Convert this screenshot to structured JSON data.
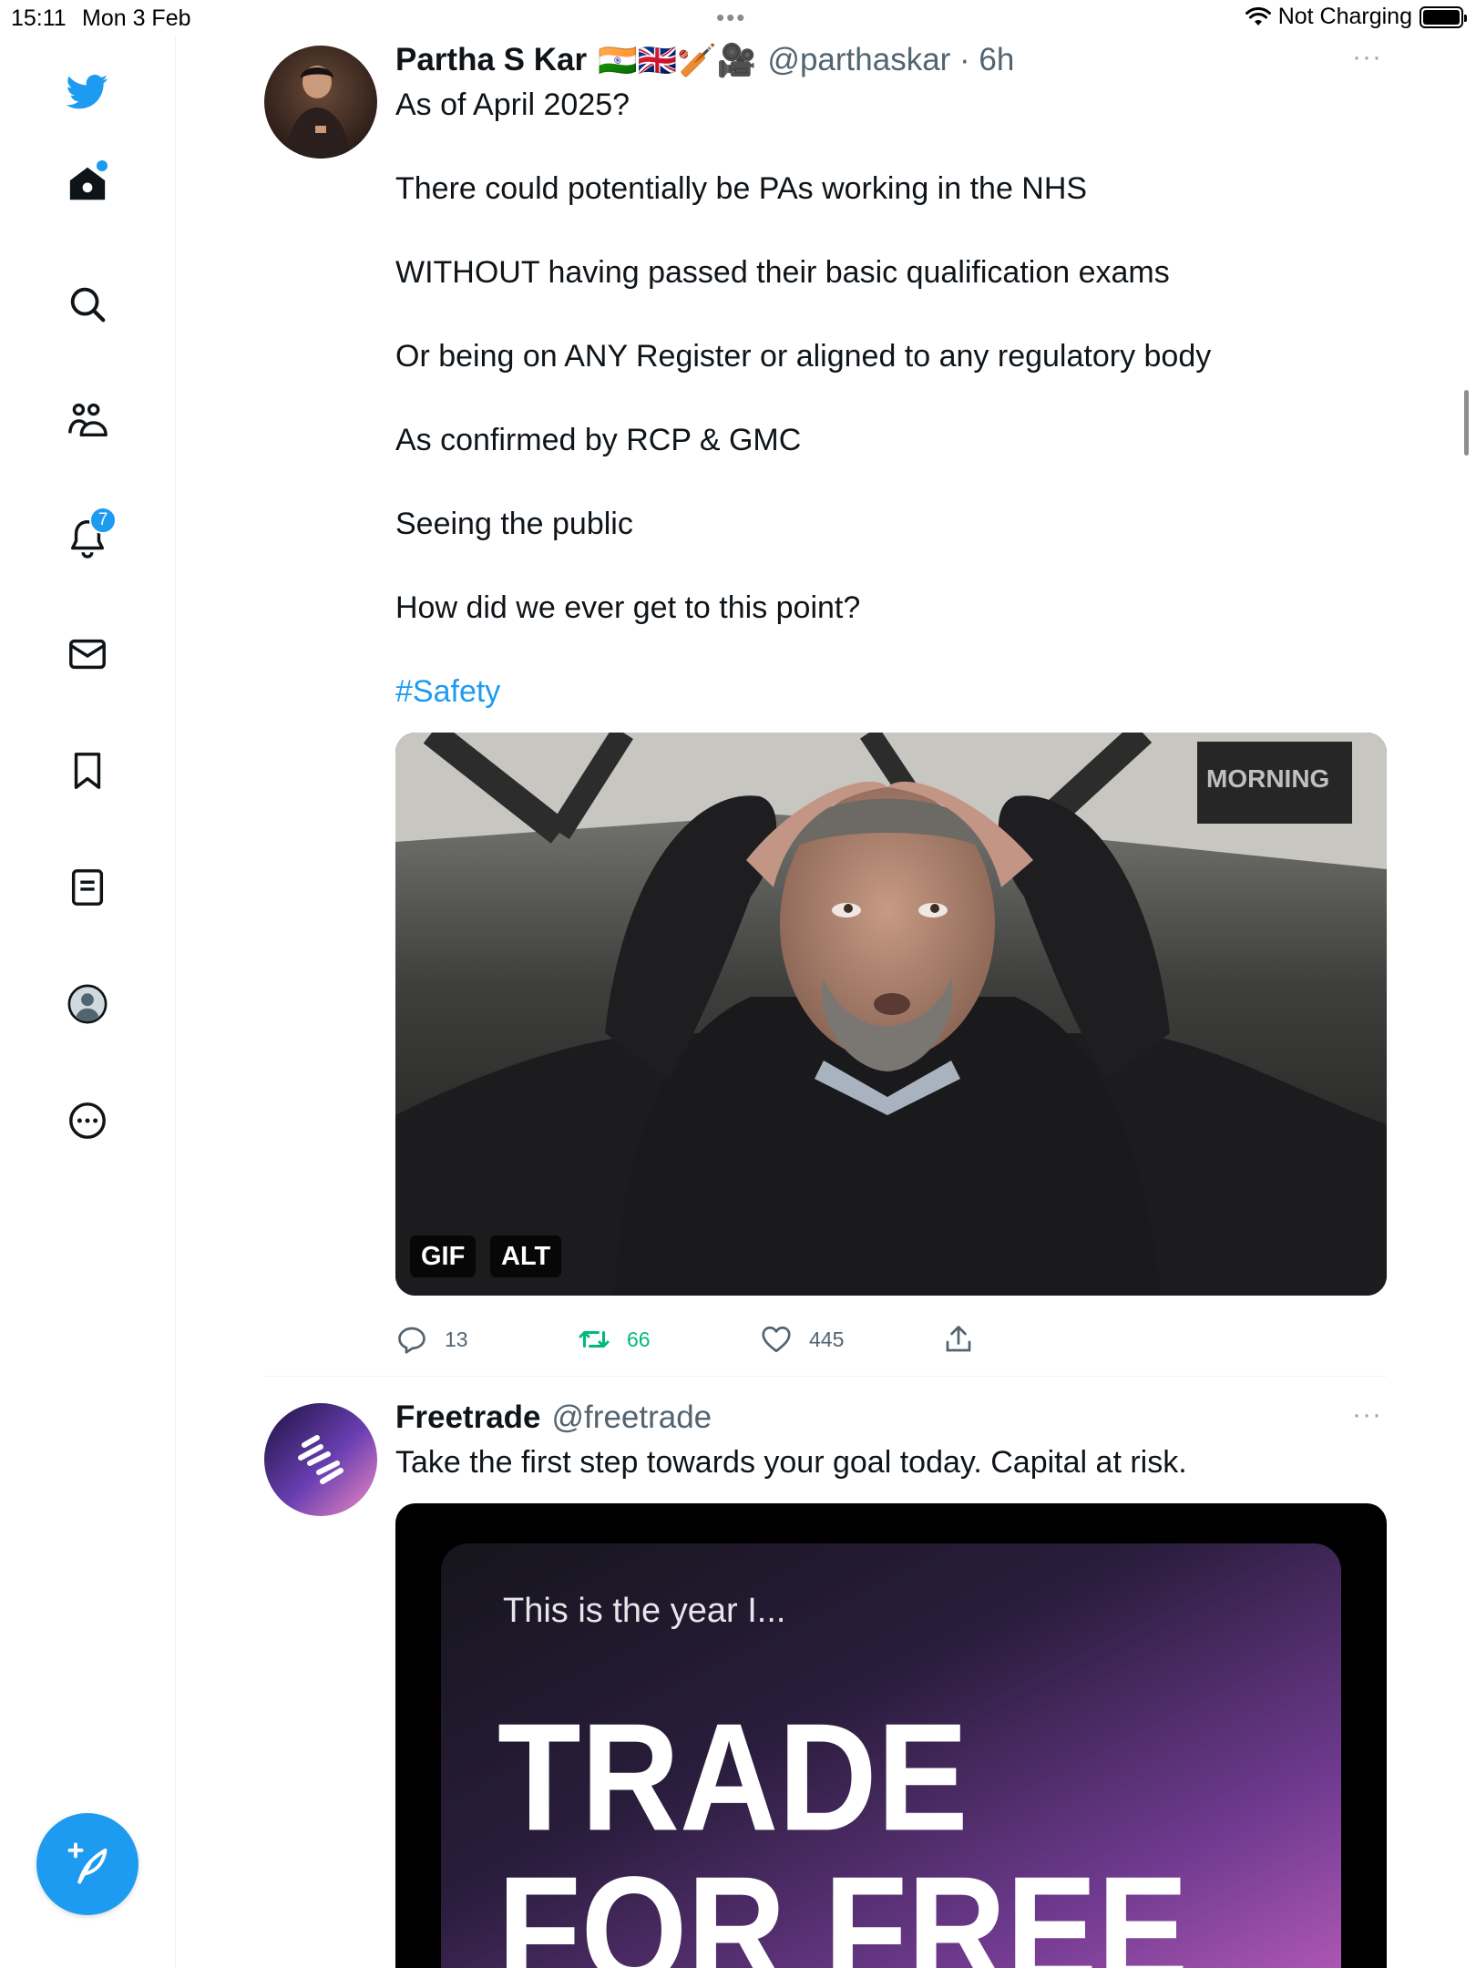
{
  "status_bar": {
    "time": "15:11",
    "date": "Mon 3 Feb",
    "dots": "•••",
    "charging": "Not Charging"
  },
  "sidebar": {
    "items": [
      {
        "name": "twitter-logo-icon"
      },
      {
        "name": "home-icon"
      },
      {
        "name": "search-icon"
      },
      {
        "name": "communities-icon"
      },
      {
        "name": "notifications-icon",
        "badge": "7"
      },
      {
        "name": "messages-icon"
      },
      {
        "name": "bookmarks-icon"
      },
      {
        "name": "lists-icon"
      },
      {
        "name": "profile-icon"
      },
      {
        "name": "more-icon"
      }
    ],
    "compose_icon": "compose-feather-icon"
  },
  "colors": {
    "accent": "#1d9bf0",
    "retweet_green": "#00ba7c",
    "secondary_text": "#536471"
  },
  "tweets": [
    {
      "name": "Partha S Kar",
      "emojis": "🇮🇳🇬🇧🏏🎥",
      "handle": "@parthaskar · 6h",
      "more": "···",
      "lines": [
        "As of April 2025?",
        "There could potentially be PAs working in the NHS",
        "WITHOUT having passed their basic qualification exams",
        "Or being on ANY Register or aligned to any regulatory body",
        "As confirmed by RCP & GMC",
        "Seeing the public",
        "How did we ever get to this point?"
      ],
      "hashtag": "#Safety",
      "media": {
        "gif_label": "GIF",
        "alt_label": "ALT",
        "watermark": "MORNING"
      },
      "stats": {
        "replies": "13",
        "retweets": "66",
        "likes": "445"
      }
    },
    {
      "name": "Freetrade",
      "handle": "@freetrade",
      "more": "···",
      "text": "Take the first step towards your goal today. Capital at risk.",
      "media": {
        "tagline": "This is the year I...",
        "headline_line1": "TRADE",
        "headline_line2": "FOR FREE"
      }
    }
  ]
}
